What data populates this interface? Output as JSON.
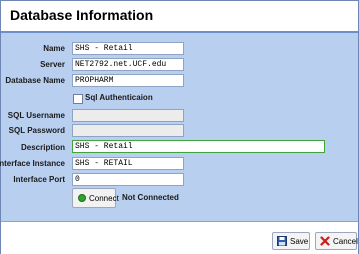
{
  "window": {
    "title": "Database Information"
  },
  "form": {
    "name": {
      "label": "Name",
      "value": "SHS - Retail"
    },
    "server": {
      "label": "Server",
      "value": "NET2792.net.UCF.edu"
    },
    "database_name": {
      "label": "Database Name",
      "value": "PROPHARM"
    },
    "sql_auth": {
      "label": "Sql Authenticaion",
      "checked": false
    },
    "sql_username": {
      "label": "SQL Username",
      "value": ""
    },
    "sql_password": {
      "label": "SQL Password",
      "value": ""
    },
    "description": {
      "label": "Description",
      "value": "SHS - Retail"
    },
    "interface_instance": {
      "label": "Interface Instance",
      "value": "SHS - RETAIL"
    },
    "interface_port": {
      "label": "Interface Port",
      "value": "0"
    }
  },
  "connect": {
    "label": "Connect",
    "status": "Not Connected",
    "icon": "green-circle-icon"
  },
  "footer": {
    "save_label": "Save",
    "save_icon": "floppy-disk-icon",
    "cancel_label": "Cancel",
    "cancel_icon": "red-x-icon"
  },
  "colors": {
    "panel": "#b9cff0",
    "header_rule": "#6c8ec9",
    "focus_border": "#3fa33f"
  }
}
